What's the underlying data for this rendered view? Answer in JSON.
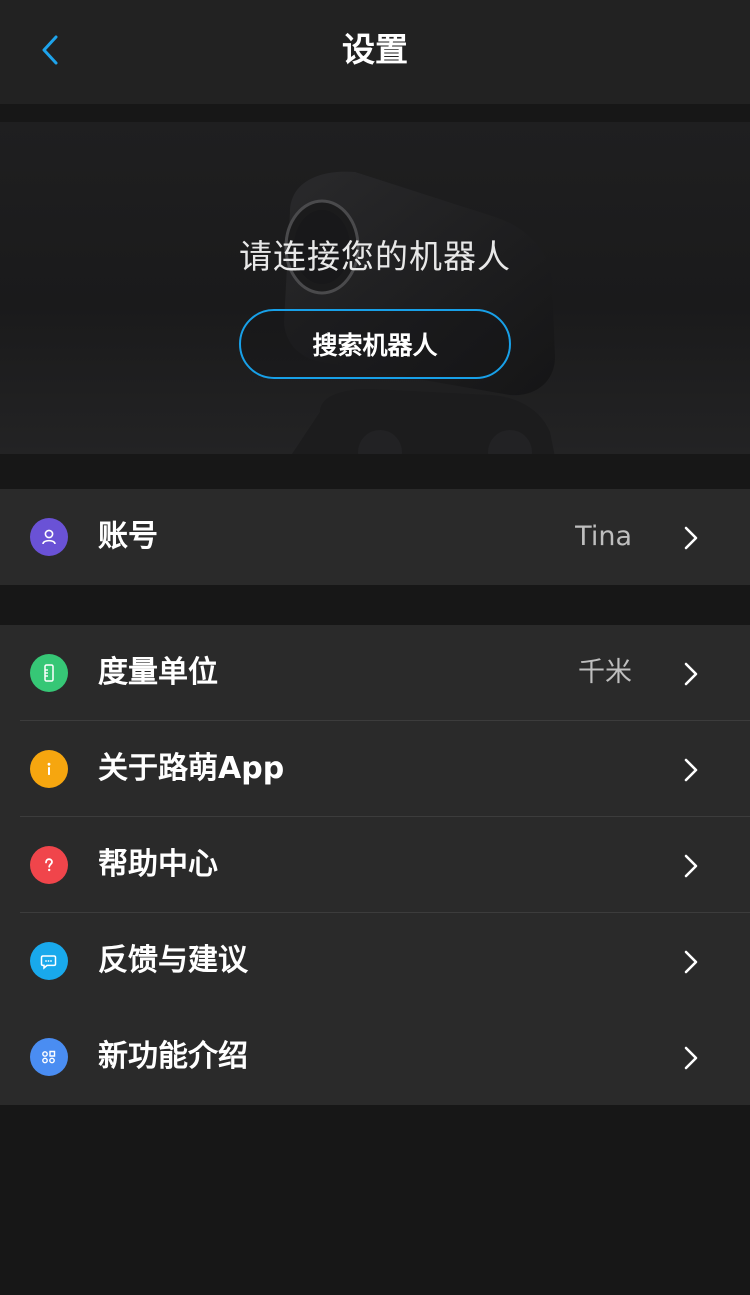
{
  "header": {
    "title": "设置",
    "back_icon": "chevron-left-icon",
    "back_color": "#1ea4ec"
  },
  "hero": {
    "prompt": "请连接您的机器人",
    "search_button": "搜索机器人",
    "accent": "#18a0e8"
  },
  "account": {
    "label": "账号",
    "value": "Tina",
    "icon": "user-icon",
    "icon_color": "#6a52d6"
  },
  "settings": {
    "items": [
      {
        "label": "度量单位",
        "value": "千米",
        "icon": "ruler-icon",
        "icon_color": "#36c776"
      },
      {
        "label": "关于路萌App",
        "value": "",
        "icon": "info-icon",
        "icon_color": "#f6a60f"
      },
      {
        "label": "帮助中心",
        "value": "",
        "icon": "question-icon",
        "icon_color": "#f0454b"
      },
      {
        "label": "反馈与建议",
        "value": "",
        "icon": "chat-icon",
        "icon_color": "#19a9ec"
      },
      {
        "label": "新功能介绍",
        "value": "",
        "icon": "features-icon",
        "icon_color": "#4a8df2"
      }
    ]
  }
}
